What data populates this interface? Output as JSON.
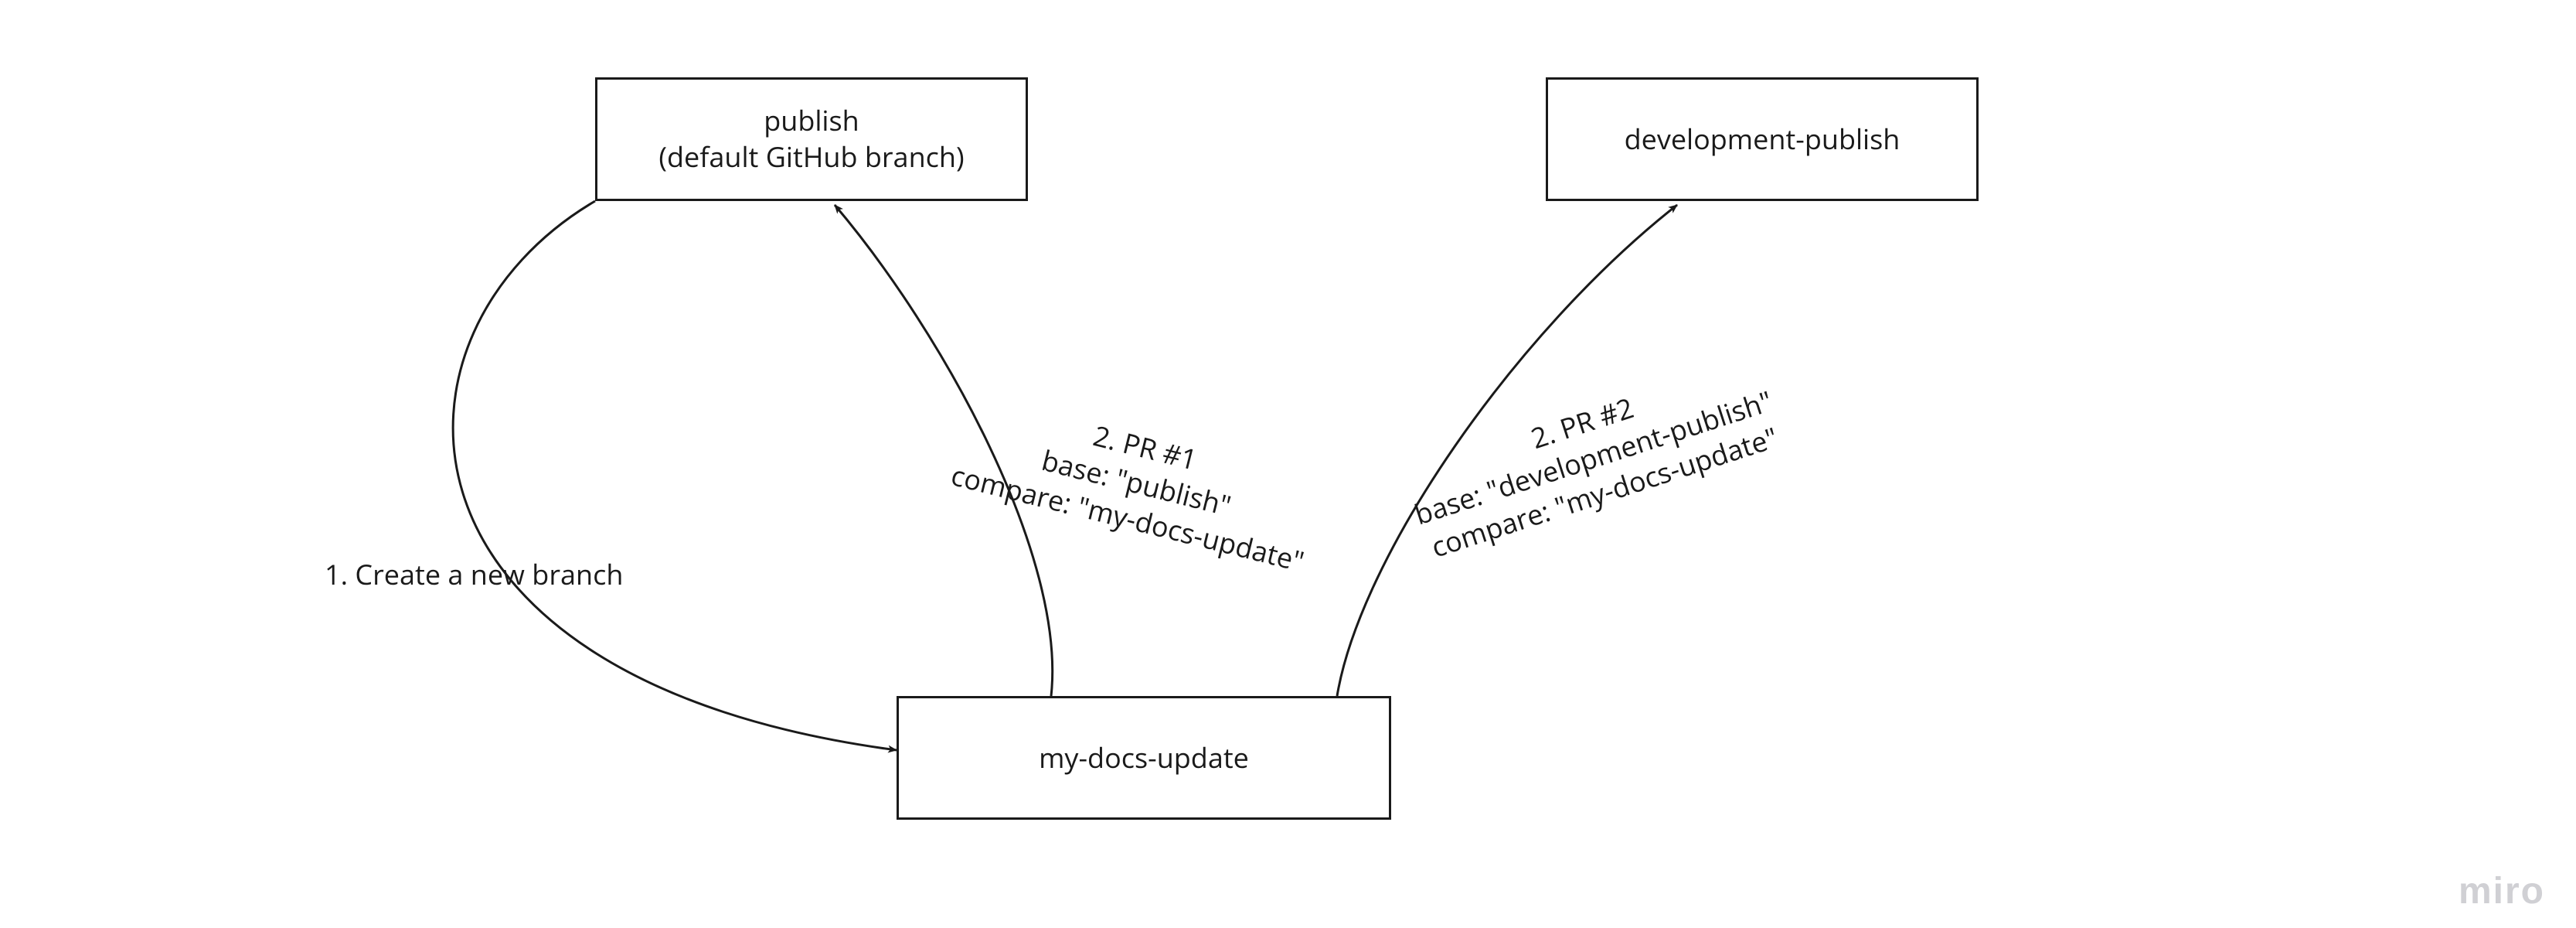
{
  "boxes": {
    "publish": {
      "line1": "publish",
      "line2": "(default GitHub branch)"
    },
    "devpublish": {
      "line1": "development-publish"
    },
    "mydocs": {
      "line1": "my-docs-update"
    }
  },
  "labels": {
    "create_branch": "1. Create a new branch",
    "pr1": {
      "l1": "2. PR #1",
      "l2": "base: \"publish\"",
      "l3": "compare: \"my-docs-update\""
    },
    "pr2": {
      "l1": "2. PR #2",
      "l2": "base: \"development-publish\"",
      "l3": "compare: \"my-docs-update\""
    }
  },
  "watermark": "miro"
}
